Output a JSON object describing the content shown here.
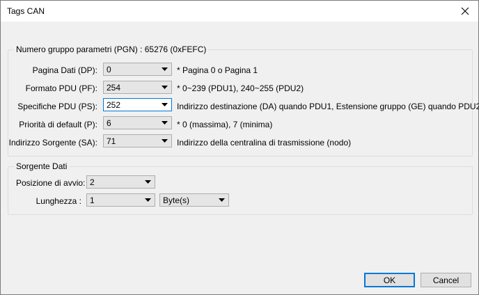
{
  "window": {
    "title": "Tags CAN"
  },
  "group1": {
    "legend": "Numero gruppo parametri (PGN) : 65276 (0xFEFC)",
    "rows": [
      {
        "label": "Pagina Dati (DP):",
        "value": "0",
        "hint": "* Pagina 0 o Pagina 1"
      },
      {
        "label": "Formato PDU (PF):",
        "value": "254",
        "hint": "* 0~239 (PDU1), 240~255 (PDU2)"
      },
      {
        "label": "Specifiche PDU (PS):",
        "value": "252",
        "hint": "Indirizzo destinazione (DA) quando PDU1, Estensione gruppo (GE) quando PDU2"
      },
      {
        "label": "Priorità di default (P):",
        "value": "6",
        "hint": "* 0 (massima), 7 (minima)"
      },
      {
        "label": "Indirizzo Sorgente (SA):",
        "value": "71",
        "hint": "Indirizzo della centralina di trasmissione (nodo)"
      }
    ]
  },
  "group2": {
    "legend": "Sorgente Dati",
    "start_label": "Posizione di avvio:",
    "start_value": "2",
    "length_label": "Lunghezza :",
    "length_value": "1",
    "unit_value": "Byte(s)"
  },
  "buttons": {
    "ok": "OK",
    "cancel": "Cancel"
  },
  "icons": {
    "close": "close-icon",
    "dropdown": "chevron-down-icon"
  },
  "colors": {
    "focus": "#0078d7",
    "background": "#f0f0f0",
    "combo": "#e5e5e5"
  }
}
